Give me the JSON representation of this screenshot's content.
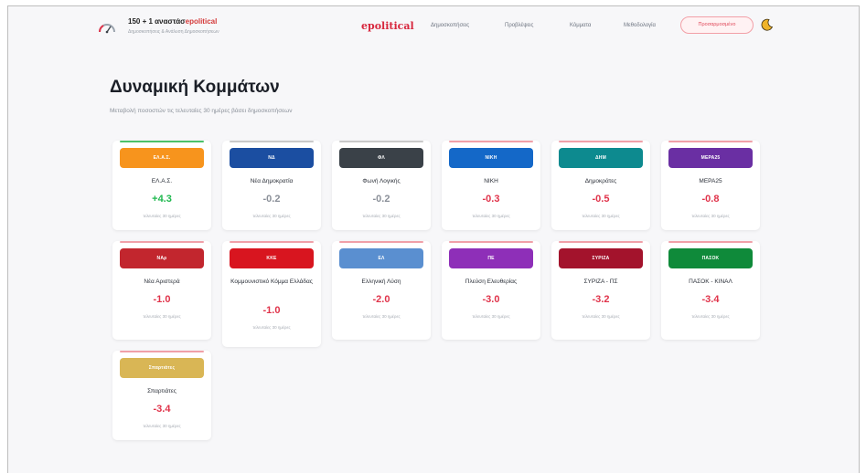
{
  "header": {
    "brand_title_main": "150 + 1 ",
    "brand_title_rest": "αναστάσ",
    "brand_title_accent": "epolitical",
    "brand_subtitle": "Δημοσκοπήσεις & Ανάλυση Δημοσκοπήσεων",
    "logo_text": "epolitical",
    "nav": [
      {
        "label": "Δημοσκοπήσεις"
      },
      {
        "label": "Προβλέψεις"
      },
      {
        "label": "Κόμματα"
      },
      {
        "label": "Μεθοδολογία"
      }
    ],
    "cta_label": "Προσαρμοσμένο",
    "icons": {
      "logo": "gauge-icon",
      "theme": "moon-icon"
    }
  },
  "page": {
    "title": "Δυναμική Κομμάτων",
    "subtitle": "Μεταβολή ποσοστών τις τελευταίες 30 ημέρες βάσει δημοσκοπήσεων"
  },
  "cards": [
    {
      "badge": "ΕΛ.Α.Σ.",
      "name": "ΕΛ.Α.Σ.",
      "value": "+4.3",
      "trend": "pos",
      "period": "τελευταίες 30 ημέρες",
      "color": "#f7941d",
      "line": "#4cc26b"
    },
    {
      "badge": "ΝΔ",
      "name": "Νέα Δημοκρατία",
      "value": "-0.2",
      "trend": "neu",
      "period": "τελευταίες 30 ημέρες",
      "color": "#1b4ea1",
      "line": "#c9c9c9"
    },
    {
      "badge": "ΦΛ",
      "name": "Φωνή Λογικής",
      "value": "-0.2",
      "trend": "neu",
      "period": "τελευταίες 30 ημέρες",
      "color": "#3a4148",
      "line": "#c9c9c9"
    },
    {
      "badge": "ΝΙΚΗ",
      "name": "ΝΙΚΗ",
      "value": "-0.3",
      "trend": "neg",
      "period": "τελευταίες 30 ημέρες",
      "color": "#1468c8",
      "line": "#f0a0a8"
    },
    {
      "badge": "ΔΗΜ",
      "name": "Δημοκράτες",
      "value": "-0.5",
      "trend": "neg",
      "period": "τελευταίες 30 ημέρες",
      "color": "#0d8a8f",
      "line": "#f0a0a8"
    },
    {
      "badge": "ΜΕΡΑ25",
      "name": "ΜΕΡΑ25",
      "value": "-0.8",
      "trend": "neg",
      "period": "τελευταίες 30 ημέρες",
      "color": "#6a2fa3",
      "line": "#f0a0a8"
    },
    {
      "badge": "ΝΑρ",
      "name": "Νέα Αριστερά",
      "value": "-1.0",
      "trend": "neg",
      "period": "τελευταίες 30 ημέρες",
      "color": "#c2262e",
      "line": "#f0a0a8"
    },
    {
      "badge": "ΚΚΕ",
      "name": "Κομμουνιστικό Κόμμα Ελλάδας",
      "value": "-1.0",
      "trend": "neg",
      "period": "τελευταίες 30 ημέρες",
      "color": "#d8151f",
      "line": "#f0a0a8"
    },
    {
      "badge": "ΕΛ",
      "name": "Ελληνική Λύση",
      "value": "-2.0",
      "trend": "neg",
      "period": "τελευταίες 30 ημέρες",
      "color": "#5a8fd0",
      "line": "#f0a0a8"
    },
    {
      "badge": "ΠΕ",
      "name": "Πλεύση Ελευθερίας",
      "value": "-3.0",
      "trend": "neg",
      "period": "τελευταίες 30 ημέρες",
      "color": "#8e2fb8",
      "line": "#f0a0a8"
    },
    {
      "badge": "ΣΥΡΙΖΑ",
      "name": "ΣΥΡΙΖΑ - ΠΣ",
      "value": "-3.2",
      "trend": "neg",
      "period": "τελευταίες 30 ημέρες",
      "color": "#a3132c",
      "line": "#f0a0a8"
    },
    {
      "badge": "ΠΑΣΟΚ",
      "name": "ΠΑΣΟΚ - ΚΙΝΑΛ",
      "value": "-3.4",
      "trend": "neg",
      "period": "τελευταίες 30 ημέρες",
      "color": "#0f8a3a",
      "line": "#f0a0a8"
    },
    {
      "badge": "Σπαρτιάτες",
      "name": "Σπαρτιάτες",
      "value": "-3.4",
      "trend": "neg",
      "period": "τελευταίες 30 ημέρες",
      "color": "#d9b655",
      "line": "#f0a0a8"
    }
  ]
}
